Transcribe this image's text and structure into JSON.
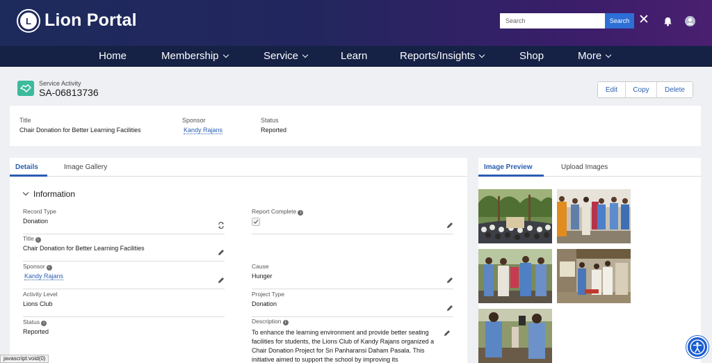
{
  "header": {
    "brand": "Lion Portal",
    "search_placeholder": "Search",
    "search_button": "Search"
  },
  "nav": {
    "items": [
      {
        "label": "Home",
        "dropdown": false
      },
      {
        "label": "Membership",
        "dropdown": true
      },
      {
        "label": "Service",
        "dropdown": true
      },
      {
        "label": "Learn",
        "dropdown": false
      },
      {
        "label": "Reports/Insights",
        "dropdown": true
      },
      {
        "label": "Shop",
        "dropdown": false
      },
      {
        "label": "More",
        "dropdown": true
      }
    ]
  },
  "record": {
    "type_label": "Service Activity",
    "id": "SA-06813736",
    "actions": [
      "Edit",
      "Copy",
      "Delete"
    ]
  },
  "summary": {
    "title_label": "Title",
    "title_value": "Chair Donation for Better Learning Facilities",
    "sponsor_label": "Sponsor",
    "sponsor_value": "Kandy Rajans",
    "status_label": "Status",
    "status_value": "Reported"
  },
  "details": {
    "tabs": [
      "Details",
      "Image Gallery"
    ],
    "section_title": "Information",
    "fields": {
      "record_type": {
        "label": "Record Type",
        "value": "Donation"
      },
      "report_complete": {
        "label": "Report Complete",
        "checked": true
      },
      "title": {
        "label": "Title",
        "value": "Chair Donation for Better Learning Facilities"
      },
      "sponsor": {
        "label": "Sponsor",
        "value": "Kandy Rajans"
      },
      "cause": {
        "label": "Cause",
        "value": "Hunger"
      },
      "activity_level": {
        "label": "Activity Level",
        "value": "Lions Club"
      },
      "project_type": {
        "label": "Project Type",
        "value": "Donation"
      },
      "status": {
        "label": "Status",
        "value": "Reported"
      },
      "description": {
        "label": "Description",
        "value": "To enhance the learning environment and provide better seating facilities for students, the Lions Club of Kandy Rajans organized a Chair Donation Project for Sri Panharansi Daham Pasala. This initiative aimed to support the school by improving its"
      }
    }
  },
  "images_panel": {
    "tabs": [
      "Image Preview",
      "Upload Images"
    ]
  },
  "statusbar": "javascript:void(0)",
  "colors": {
    "accent": "#2a5db0",
    "nav_bg": "#152145",
    "record_icon": "#3bba9c"
  }
}
